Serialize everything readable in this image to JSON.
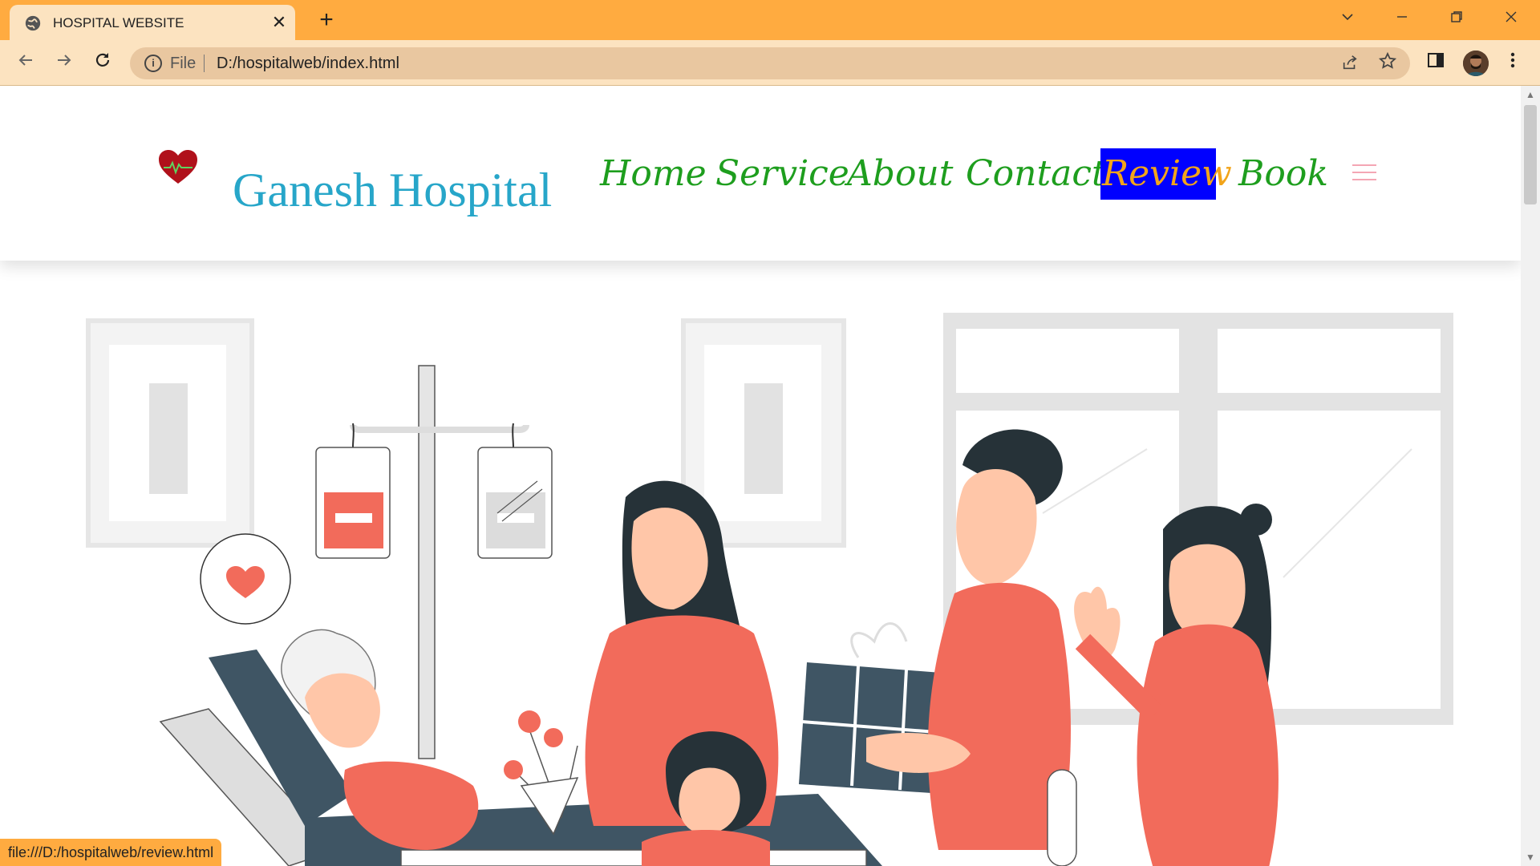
{
  "browser": {
    "tab_title": "HOSPITAL WEBSITE",
    "close_glyph": "✕",
    "new_tab_glyph": "+",
    "scheme_label": "File",
    "url": "D:/hospitalweb/index.html",
    "status_url": "file:///D:/hospitalweb/review.html",
    "accent_color": "#FFAB40"
  },
  "site": {
    "brand": "Ganesh Hospital",
    "brand_color": "#27A6C9",
    "nav_color": "#1E9E1E",
    "nav": [
      {
        "label": "Home",
        "active": false
      },
      {
        "label": "Service",
        "active": false
      },
      {
        "label": "About",
        "active": false
      },
      {
        "label": "Contact",
        "active": false
      },
      {
        "label": "Review",
        "active": true
      },
      {
        "label": "Book",
        "active": false
      }
    ],
    "active_bg": "#0000FF",
    "active_text": "#F2A41A"
  },
  "icons": [
    "globe-icon",
    "close-icon",
    "plus-icon",
    "chevron-down-icon",
    "minimize-icon",
    "restore-icon",
    "window-close-icon",
    "back-arrow-icon",
    "forward-arrow-icon",
    "reload-icon",
    "info-icon",
    "share-icon",
    "star-icon",
    "sidebar-icon",
    "avatar",
    "kebab-menu-icon",
    "heart-pulse-icon",
    "hamburger-icon"
  ]
}
